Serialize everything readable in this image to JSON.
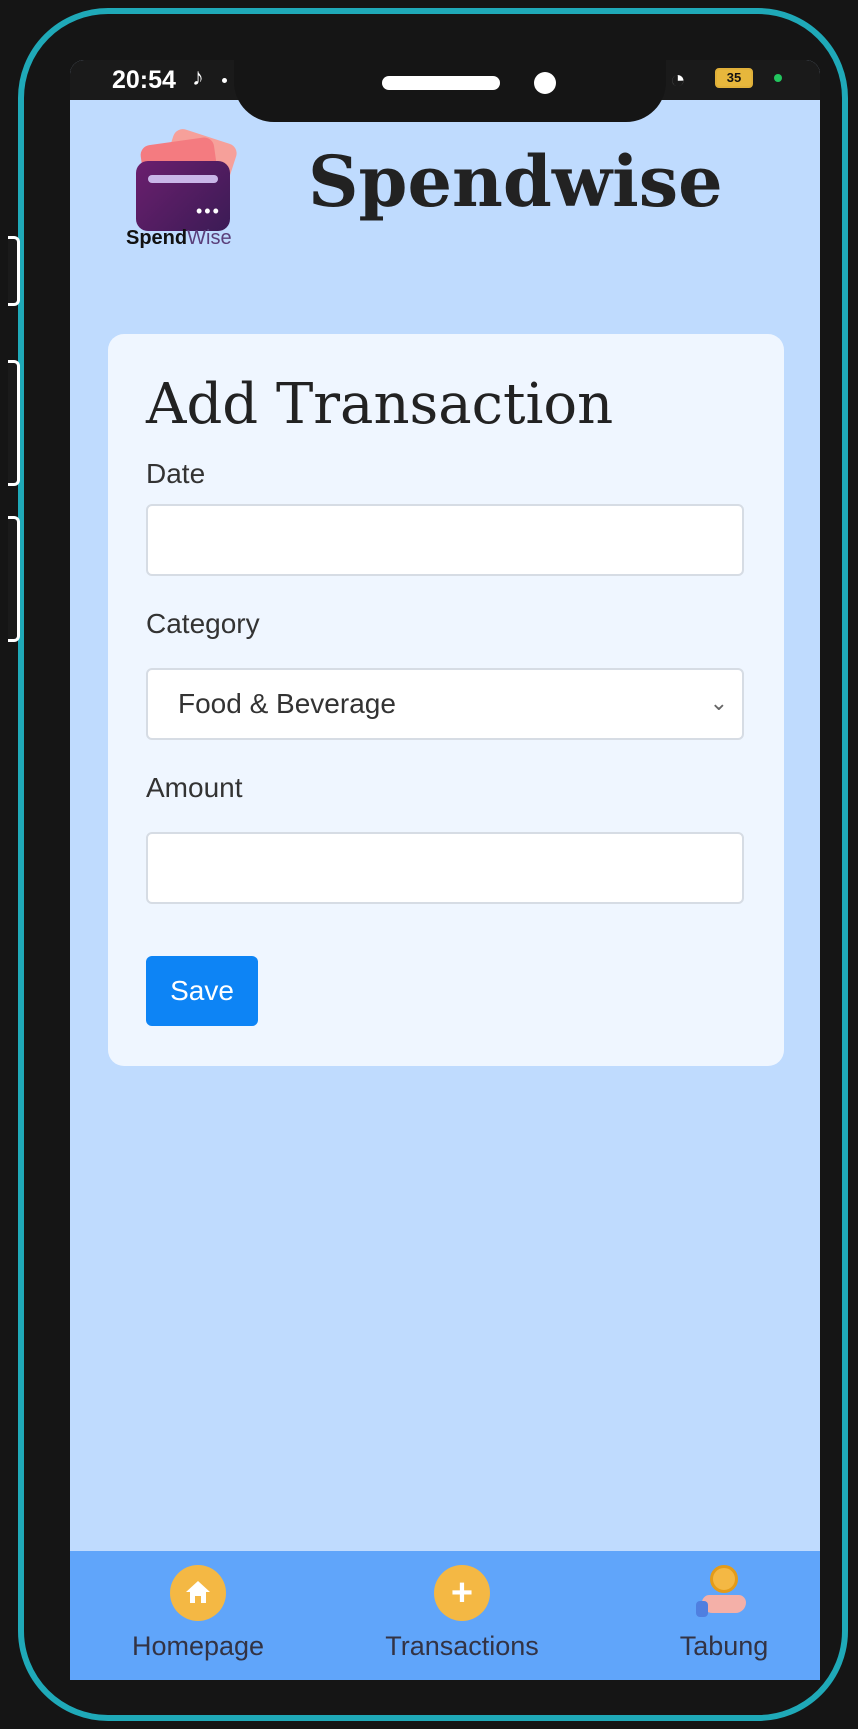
{
  "status_bar": {
    "time": "20:54",
    "battery": "35"
  },
  "header": {
    "logo_brand_bold": "Spend",
    "logo_brand_light": "Wise",
    "app_title": "Spendwise"
  },
  "form": {
    "title": "Add Transaction",
    "date_label": "Date",
    "date_value": "",
    "category_label": "Category",
    "category_selected": "Food & Beverage",
    "amount_label": "Amount",
    "amount_value": "",
    "save_label": "Save"
  },
  "bottom_nav": {
    "items": [
      {
        "label": "Homepage",
        "icon": "home-icon"
      },
      {
        "label": "Transactions",
        "icon": "plus-icon"
      },
      {
        "label": "Tabung",
        "icon": "coin-hand-icon"
      }
    ]
  },
  "colors": {
    "frame": "#1fa9b8",
    "screen_bg": "#bfdbfe",
    "card_bg": "#eff6ff",
    "primary_button": "#0d84f5",
    "nav_bg": "#60a5fa",
    "nav_icon": "#f4b844"
  }
}
